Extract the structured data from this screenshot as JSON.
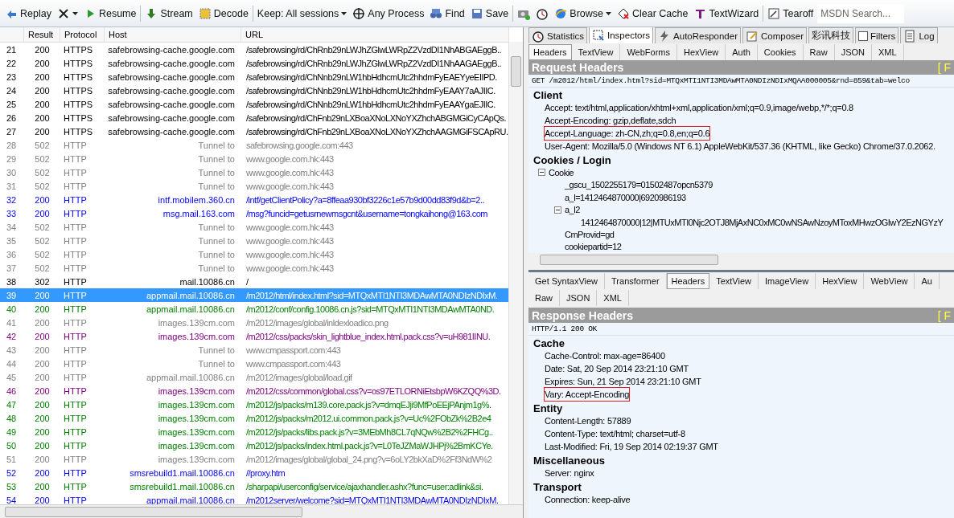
{
  "toolbar": {
    "items": [
      {
        "kind": "replay",
        "label": "Replay"
      },
      {
        "kind": "remove"
      },
      {
        "kind": "resume",
        "label": "Resume"
      },
      {
        "kind": "sep"
      },
      {
        "kind": "stream",
        "label": "Stream"
      },
      {
        "kind": "decode",
        "label": "Decode"
      },
      {
        "kind": "sep"
      },
      {
        "kind": "keep",
        "label": "Keep: All sessions"
      },
      {
        "kind": "process",
        "label": "Any Process"
      },
      {
        "kind": "find",
        "label": "Find"
      },
      {
        "kind": "save",
        "label": "Save"
      },
      {
        "kind": "sep"
      },
      {
        "kind": "camera"
      },
      {
        "kind": "timer"
      },
      {
        "kind": "browse",
        "label": "Browse"
      },
      {
        "kind": "clear",
        "label": "Clear Cache"
      },
      {
        "kind": "wizard",
        "label": "TextWizard"
      },
      {
        "kind": "sep"
      },
      {
        "kind": "tearoff",
        "label": "Tearoff"
      }
    ],
    "search": {
      "placeholder": "MSDN Search..."
    }
  },
  "sessions": {
    "columns": [
      "",
      "Result",
      "Protocol",
      "Host",
      "URL"
    ],
    "rows": [
      {
        "id": "21",
        "result": "200",
        "protocol": "HTTPS",
        "host": "safebrowsing-cache.google.com",
        "url": "/safebrowsing/rd/ChRnb29nLWJhZGlwLWRpZ2VzdDI1NhABGAEggB..",
        "color": "#000000",
        "selected": false
      },
      {
        "id": "22",
        "result": "200",
        "protocol": "HTTPS",
        "host": "safebrowsing-cache.google.com",
        "url": "/safebrowsing/rd/ChRnb29nLWJhZGlwLWRpZ2VzdDI1NhAAGAEggB..",
        "color": "#000000",
        "selected": false
      },
      {
        "id": "23",
        "result": "200",
        "protocol": "HTTPS",
        "host": "safebrowsing-cache.google.com",
        "url": "/safebrowsing/rd/ChNnb29nLW1hbHdhcmUtc2hhdmFyEAEYyeEIIPD.",
        "color": "#000000",
        "selected": false
      },
      {
        "id": "24",
        "result": "200",
        "protocol": "HTTPS",
        "host": "safebrowsing-cache.google.com",
        "url": "/safebrowsing/rd/ChNnb29nLW1hbHdhcmUtc2hhdmFyEAAY7aAJIIC.",
        "color": "#000000",
        "selected": false
      },
      {
        "id": "25",
        "result": "200",
        "protocol": "HTTPS",
        "host": "safebrowsing-cache.google.com",
        "url": "/safebrowsing/rd/ChNnb29nLW1hbHdhcmUtc2hhdmFyEAAYgaEJIIC.",
        "color": "#000000",
        "selected": false
      },
      {
        "id": "26",
        "result": "200",
        "protocol": "HTTPS",
        "host": "safebrowsing-cache.google.com",
        "url": "/safebrowsing/rd/ChFnb29nLXBoaXNoLXNoYXZhchABGMGiCyCApQs.",
        "color": "#000000",
        "selected": false
      },
      {
        "id": "27",
        "result": "200",
        "protocol": "HTTPS",
        "host": "safebrowsing-cache.google.com",
        "url": "/safebrowsing/rd/ChFnb29nLXBoaXNoLXNoYXZhchAAGMGiFSCApRU.",
        "color": "#000000",
        "selected": false
      },
      {
        "id": "28",
        "result": "502",
        "protocol": "HTTP",
        "host": "Tunnel to",
        "url": "safebrowsing.google.com:443",
        "color": "#808080",
        "selected": false
      },
      {
        "id": "29",
        "result": "502",
        "protocol": "HTTP",
        "host": "Tunnel to",
        "url": "www.google.com.hk:443",
        "color": "#808080",
        "selected": false
      },
      {
        "id": "30",
        "result": "502",
        "protocol": "HTTP",
        "host": "Tunnel to",
        "url": "www.google.com.hk:443",
        "color": "#808080",
        "selected": false
      },
      {
        "id": "31",
        "result": "502",
        "protocol": "HTTP",
        "host": "Tunnel to",
        "url": "www.google.com.hk:443",
        "color": "#808080",
        "selected": false
      },
      {
        "id": "32",
        "result": "200",
        "protocol": "HTTP",
        "host": "intf.mobilem.360.cn",
        "url": "/intf/getClientPolicy?a=8ffeaa930bf3226c1e57b9d00dd83f9d&b=2..",
        "color": "#0000ff",
        "selected": false
      },
      {
        "id": "33",
        "result": "200",
        "protocol": "HTTP",
        "host": "msg.mail.163.com",
        "url": "/msg?funcid=getusrnewmsgcnt&username=tongkaihong@163.com",
        "color": "#0000ff",
        "selected": false
      },
      {
        "id": "34",
        "result": "502",
        "protocol": "HTTP",
        "host": "Tunnel to",
        "url": "www.google.com.hk:443",
        "color": "#808080",
        "selected": false
      },
      {
        "id": "35",
        "result": "502",
        "protocol": "HTTP",
        "host": "Tunnel to",
        "url": "www.google.com.hk:443",
        "color": "#808080",
        "selected": false
      },
      {
        "id": "36",
        "result": "502",
        "protocol": "HTTP",
        "host": "Tunnel to",
        "url": "www.google.com.hk:443",
        "color": "#808080",
        "selected": false
      },
      {
        "id": "37",
        "result": "502",
        "protocol": "HTTP",
        "host": "Tunnel to",
        "url": "www.google.com.hk:443",
        "color": "#808080",
        "selected": false
      },
      {
        "id": "38",
        "result": "302",
        "protocol": "HTTP",
        "host": "mail.10086.cn",
        "url": "/",
        "color": "#000000",
        "selected": false
      },
      {
        "id": "39",
        "result": "200",
        "protocol": "HTTP",
        "host": "appmail.mail.10086.cn",
        "url": "/m2012/html/index.html?sid=MTQxMTI1NTI3MDAwMTA0NDIzNDIxM.",
        "selected": true
      },
      {
        "id": "40",
        "result": "200",
        "protocol": "HTTP",
        "host": "appmail.mail.10086.cn",
        "url": "/m2012/conf/config.10086.cn.js?sid=MTQxMTI1NTI3MDAwMTA0ND.",
        "color": "#008000",
        "selected": false
      },
      {
        "id": "41",
        "result": "200",
        "protocol": "HTTP",
        "host": "images.139cm.com",
        "url": "/m2012/images/global/inldexloadico.png",
        "color": "#808080",
        "selected": false
      },
      {
        "id": "42",
        "result": "200",
        "protocol": "HTTP",
        "host": "images.139cm.com",
        "url": "/m2012/css/packs/skin_lightblue_index.html.pack.css?v=uH981IINU.",
        "color": "#800080",
        "selected": false
      },
      {
        "id": "43",
        "result": "200",
        "protocol": "HTTP",
        "host": "Tunnel to",
        "url": "www.cmpassport.com:443",
        "color": "#808080",
        "selected": false
      },
      {
        "id": "44",
        "result": "200",
        "protocol": "HTTP",
        "host": "Tunnel to",
        "url": "www.cmpassport.com:443",
        "color": "#808080",
        "selected": false
      },
      {
        "id": "45",
        "result": "200",
        "protocol": "HTTP",
        "host": "appmail.mail.10086.cn",
        "url": "/m2012/images/global/load.gif",
        "color": "#808080",
        "selected": false
      },
      {
        "id": "46",
        "result": "200",
        "protocol": "HTTP",
        "host": "images.139cm.com",
        "url": "/m2012/css/common/global.css?v=os97ETLORNiEtsbpW6KZQQ%3D.",
        "color": "#800080",
        "selected": false
      },
      {
        "id": "47",
        "result": "200",
        "protocol": "HTTP",
        "host": "images.139cm.com",
        "url": "/m2012/js/packs/m139.core.pack.js?v=dmqEJji9MfPoEEjPAnjm1g%.",
        "color": "#008000",
        "selected": false
      },
      {
        "id": "48",
        "result": "200",
        "protocol": "HTTP",
        "host": "images.139cm.com",
        "url": "/m2012/js/packs/m2012.ui.common.pack.js?v=Uc%2FObZk%2B2e4",
        "color": "#008000",
        "selected": false
      },
      {
        "id": "49",
        "result": "200",
        "protocol": "HTTP",
        "host": "images.139cm.com",
        "url": "/m2012/js/packs/libs.pack.js?v=3MEbMh8CL7qNQw%2B2%2FHCg..",
        "color": "#008000",
        "selected": false
      },
      {
        "id": "50",
        "result": "200",
        "protocol": "HTTP",
        "host": "images.139cm.com",
        "url": "/m2012/js/packs/index.html.pack.js?v=L0TeJZMaWJHPj%2BmKCYe.",
        "color": "#008000",
        "selected": false
      },
      {
        "id": "51",
        "result": "200",
        "protocol": "HTTP",
        "host": "images.139cm.com",
        "url": "/m2012/images/global/global_24.png?v=6oLY2bkXaD%2Ff3NdW%2",
        "color": "#808080",
        "selected": false
      },
      {
        "id": "52",
        "result": "200",
        "protocol": "HTTP",
        "host": "smsrebuild1.mail.10086.cn",
        "url": "//proxy.htm",
        "color": "#0000ff",
        "selected": false
      },
      {
        "id": "53",
        "result": "200",
        "protocol": "HTTP",
        "host": "smsrebuild1.mail.10086.cn",
        "url": "/sharpapi/userconfig/service/ajaxhandler.ashx?func=user:adlink&si.",
        "color": "#008000",
        "selected": false
      },
      {
        "id": "54",
        "result": "200",
        "protocol": "HTTP",
        "host": "appmail.mail.10086.cn",
        "url": "/m2012server/welcome?sid=MTQxMTI1NTI3MDAwMTA0NDIzNDIxM.",
        "color": "#0000ff",
        "selected": false
      }
    ]
  },
  "main_tabs": [
    {
      "kind": "timer",
      "label": "Statistics",
      "selected": false
    },
    {
      "kind": "inspect",
      "label": "Inspectors",
      "selected": true
    },
    {
      "kind": "bolt",
      "label": "AutoResponder",
      "selected": false
    },
    {
      "kind": "compose",
      "label": "Composer",
      "selected": false
    },
    {
      "kind": "plain",
      "label": "彩讯科技",
      "selected": false
    },
    {
      "kind": "check",
      "label": "Filters",
      "selected": false
    },
    {
      "kind": "log",
      "label": "Log",
      "selected": false
    }
  ],
  "request": {
    "tabs": [
      {
        "label": "Headers",
        "selected": true
      },
      {
        "label": "TextView",
        "selected": false
      },
      {
        "label": "WebForms",
        "selected": false
      },
      {
        "label": "HexView",
        "selected": false
      },
      {
        "label": "Auth",
        "selected": false
      },
      {
        "label": "Cookies",
        "selected": false
      },
      {
        "label": "Raw",
        "selected": false
      },
      {
        "label": "JSON",
        "selected": false
      },
      {
        "label": "XML",
        "selected": false
      }
    ],
    "title": "Request Headers",
    "title_link": "[ F",
    "first_line": "GET /m2012/html/index.html?sid=MTQxMTI1NTI3MDAwMTA0NDIzNDIxMQAA000005&rnd=859&tab=welco",
    "groups": [
      {
        "name": "Client",
        "items": [
          {
            "text": "Accept: text/html,application/xhtml+xml,application/xml;q=0.9,image/webp,*/*;q=0.8",
            "highlighted": false
          },
          {
            "text": "Accept-Encoding: gzip,deflate,sdch",
            "highlighted": false
          },
          {
            "text": "Accept-Language: zh-CN,zh;q=0.8,en;q=0.6",
            "highlighted": true
          },
          {
            "text": "User-Agent: Mozilla/5.0 (Windows NT 6.1) AppleWebKit/537.36 (KHTML, like Gecko) Chrome/37.0.2062.",
            "highlighted": false
          }
        ]
      },
      {
        "name": "Cookies / Login",
        "tree": [
          {
            "text": "Cookie",
            "expanded": true,
            "children": [
              {
                "text": "_gscu_1502255179=01502487opcn5379"
              },
              {
                "text": "a_l=1412464870000|6920986193"
              },
              {
                "text": "a_l2",
                "expanded": true,
                "children": [
                  {
                    "text": "1412464870000|12|MTUxMTI0Njc2OTJ8MjAxNC0xMC0wNSAwNzoyMToxMHwzOGIwY2EzNGYzY"
                  }
                ]
              },
              {
                "text": "CmProvid=gd"
              },
              {
                "text": "cookiepartid=12"
              }
            ]
          }
        ]
      }
    ]
  },
  "response": {
    "tabs": [
      {
        "label": "Get SyntaxView",
        "selected": false
      },
      {
        "label": "Transformer",
        "selected": false
      },
      {
        "label": "Headers",
        "selected": true
      },
      {
        "label": "TextView",
        "selected": false
      },
      {
        "label": "ImageView",
        "selected": false
      },
      {
        "label": "HexView",
        "selected": false
      },
      {
        "label": "WebView",
        "selected": false
      },
      {
        "label": "Au",
        "selected": false
      }
    ],
    "tabs_row2": [
      {
        "label": "Raw",
        "selected": false
      },
      {
        "label": "JSON",
        "selected": false
      },
      {
        "label": "XML",
        "selected": false
      }
    ],
    "title": "Response Headers",
    "title_link": "[ F",
    "first_line": "HTTP/1.1 200 OK",
    "groups": [
      {
        "name": "Cache",
        "items": [
          {
            "text": "Cache-Control: max-age=86400",
            "highlighted": false
          },
          {
            "text": "Date: Sat, 20 Sep 2014 23:21:10 GMT",
            "highlighted": false
          },
          {
            "text": "Expires: Sun, 21 Sep 2014 23:21:10 GMT",
            "highlighted": false
          },
          {
            "text": "Vary: Accept-Encoding",
            "highlighted": true
          }
        ]
      },
      {
        "name": "Entity",
        "items": [
          {
            "text": "Content-Length: 57889",
            "highlighted": false
          },
          {
            "text": "Content-Type: text/html; charset=utf-8",
            "highlighted": false
          },
          {
            "text": "Last-Modified: Fri, 19 Sep 2014 02:19:37 GMT",
            "highlighted": false
          }
        ]
      },
      {
        "name": "Miscellaneous",
        "items": [
          {
            "text": "Server: nginx",
            "highlighted": false
          }
        ]
      },
      {
        "name": "Transport",
        "items": [
          {
            "text": "Connection: keep-alive",
            "highlighted": false
          }
        ]
      }
    ]
  }
}
